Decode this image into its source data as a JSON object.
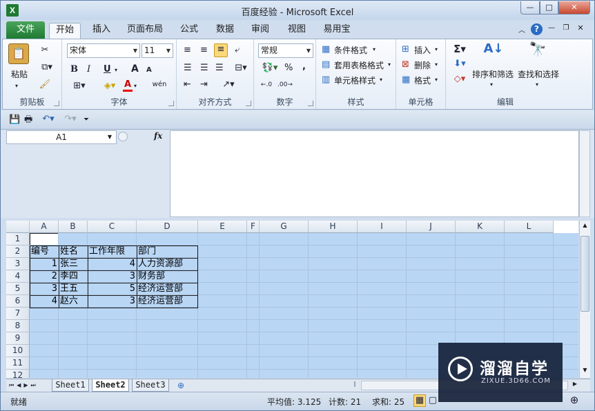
{
  "window": {
    "title": "百度经验 - Microsoft Excel",
    "app_icon": "X",
    "minimize": "—",
    "maximize": "□",
    "close": "✕"
  },
  "tabs": {
    "file": "文件",
    "items": [
      "开始",
      "插入",
      "页面布局",
      "公式",
      "数据",
      "审阅",
      "视图",
      "易用宝"
    ]
  },
  "ribbon": {
    "clipboard": {
      "label": "剪贴板",
      "paste": "粘贴"
    },
    "font": {
      "label": "字体",
      "name": "宋体",
      "size": "11",
      "bold": "B",
      "italic": "I",
      "underline": "U",
      "grow": "A",
      "shrink": "A",
      "wen": "wén",
      "font_color": "A"
    },
    "alignment": {
      "label": "对齐方式"
    },
    "number": {
      "label": "数字",
      "format": "常规",
      "percent": "%",
      "comma": ","
    },
    "styles": {
      "label": "样式",
      "conditional": "条件格式",
      "table": "套用表格格式",
      "cell": "单元格样式"
    },
    "cells": {
      "label": "单元格",
      "insert": "插入",
      "delete": "删除",
      "format": "格式"
    },
    "editing": {
      "label": "编辑",
      "sort": "排序和筛选",
      "find": "查找和选择"
    }
  },
  "formula_bar": {
    "name_box": "A1",
    "fx": "fx",
    "content": ""
  },
  "grid": {
    "columns": [
      "A",
      "B",
      "C",
      "D",
      "E",
      "F",
      "G",
      "H",
      "I",
      "J",
      "K",
      "L"
    ],
    "rows": [
      "1",
      "2",
      "3",
      "4",
      "5",
      "6",
      "7",
      "8",
      "9",
      "10",
      "11",
      "12"
    ],
    "table_header": [
      "编号",
      "姓名",
      "工作年限",
      "部门"
    ],
    "table_rows": [
      [
        "1",
        "张三",
        "4",
        "人力资源部"
      ],
      [
        "2",
        "李四",
        "3",
        "财务部"
      ],
      [
        "3",
        "王五",
        "5",
        "经济运营部"
      ],
      [
        "4",
        "赵六",
        "3",
        "经济运营部"
      ]
    ]
  },
  "sheets": [
    "Sheet1",
    "Sheet2",
    "Sheet3"
  ],
  "status": {
    "ready": "就绪",
    "average": "平均值: 3.125",
    "count": "计数: 21",
    "sum": "求和: 25"
  },
  "watermark": {
    "brand": "溜溜自学",
    "url": "ZIXUE.3D66.COM"
  }
}
